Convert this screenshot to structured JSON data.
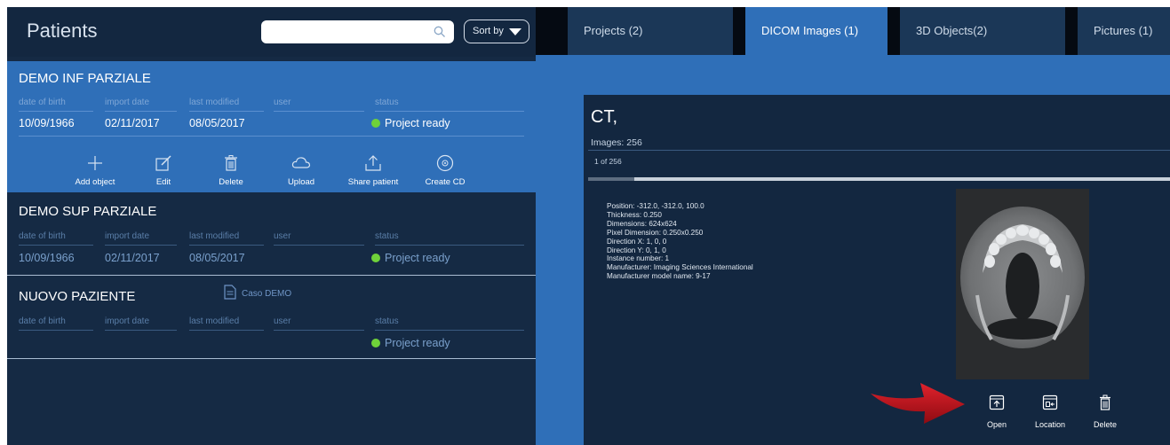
{
  "patients_panel": {
    "title": "Patients",
    "search": {
      "value": "",
      "placeholder": ""
    },
    "sort_label": "Sort by",
    "columns": [
      "date of birth",
      "import date",
      "last modified",
      "user",
      "status"
    ],
    "patients": [
      {
        "name": "DEMO INF PARZIALE",
        "date_of_birth": "10/09/1966",
        "import_date": "02/11/2017",
        "last_modified": "08/05/2017",
        "user": "",
        "status": "Project ready",
        "selected": true
      },
      {
        "name": "DEMO SUP PARZIALE",
        "date_of_birth": "10/09/1966",
        "import_date": "02/11/2017",
        "last_modified": "08/05/2017",
        "user": "",
        "status": "Project ready"
      },
      {
        "name": "NUOVO PAZIENTE",
        "tag": "Caso DEMO",
        "date_of_birth": "",
        "import_date": "",
        "last_modified": "",
        "user": "",
        "status": "Project ready"
      }
    ],
    "actions": [
      "Add object",
      "Edit",
      "Delete",
      "Upload",
      "Share patient",
      "Create CD"
    ]
  },
  "tabs": [
    {
      "label": "Projects (2)"
    },
    {
      "label": "DICOM Images (1)",
      "active": true
    },
    {
      "label": "3D Objects(2)"
    },
    {
      "label": "Pictures (1)"
    }
  ],
  "dicom": {
    "title": "CT,",
    "images_label": "Images: 256",
    "counter": "1 of 256",
    "progress_fraction": 0.08,
    "metadata": [
      "Position: -312.0, -312.0, 100.0",
      "Thickness: 0.250",
      "Dimensions: 624x624",
      "Pixel Dimension: 0.250x0.250",
      "Direction X: 1, 0, 0",
      "Direction Y: 0, 1, 0",
      "Instance number: 1",
      "Manufacturer: Imaging Sciences International",
      "Manufacturer model name: 9-17"
    ],
    "actions": [
      "Open",
      "Location",
      "Delete"
    ]
  },
  "colors": {
    "panel_bg": "#152a44",
    "accent_blue": "#2f6fb8",
    "status_green": "#6fd23a",
    "pointer_red": "#c8101e"
  }
}
